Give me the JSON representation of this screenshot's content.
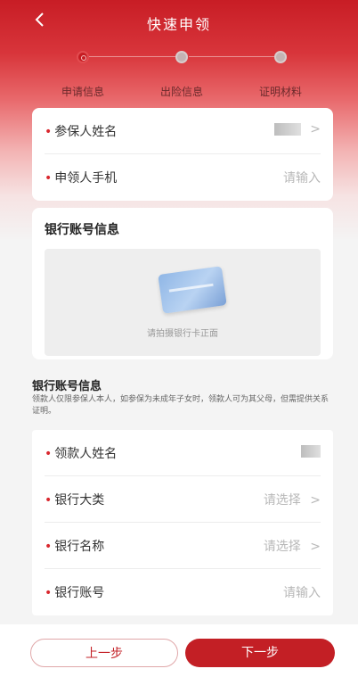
{
  "header": {
    "title": "快速申领",
    "back_icon": "chevron-left-icon"
  },
  "steps": [
    {
      "label": "申请信息",
      "state": "active"
    },
    {
      "label": "出险信息",
      "state": "inactive"
    },
    {
      "label": "证明材料",
      "state": "inactive"
    }
  ],
  "insured": {
    "rows": [
      {
        "label": "参保人姓名",
        "value": "",
        "chevron": ">"
      },
      {
        "label": "申领人手机",
        "placeholder": "请输入"
      }
    ]
  },
  "bank_card_upload": {
    "title": "银行账号信息",
    "hint": "请拍摄银行卡正面"
  },
  "bank_info": {
    "title": "银行账号信息",
    "note": "领款人仅限参保人本人，如参保为未成年子女时，领款人可为其父母，但需提供关系证明。",
    "rows": [
      {
        "label": "领款人姓名",
        "value": ""
      },
      {
        "label": "银行大类",
        "placeholder": "请选择",
        "chevron": ">"
      },
      {
        "label": "银行名称",
        "placeholder": "请选择",
        "chevron": ">"
      },
      {
        "label": "银行账号",
        "placeholder": "请输入"
      }
    ]
  },
  "footer": {
    "prev_label": "上一步",
    "next_label": "下一步"
  },
  "colors": {
    "primary": "#c31f25",
    "required_star": "#d9272e"
  }
}
